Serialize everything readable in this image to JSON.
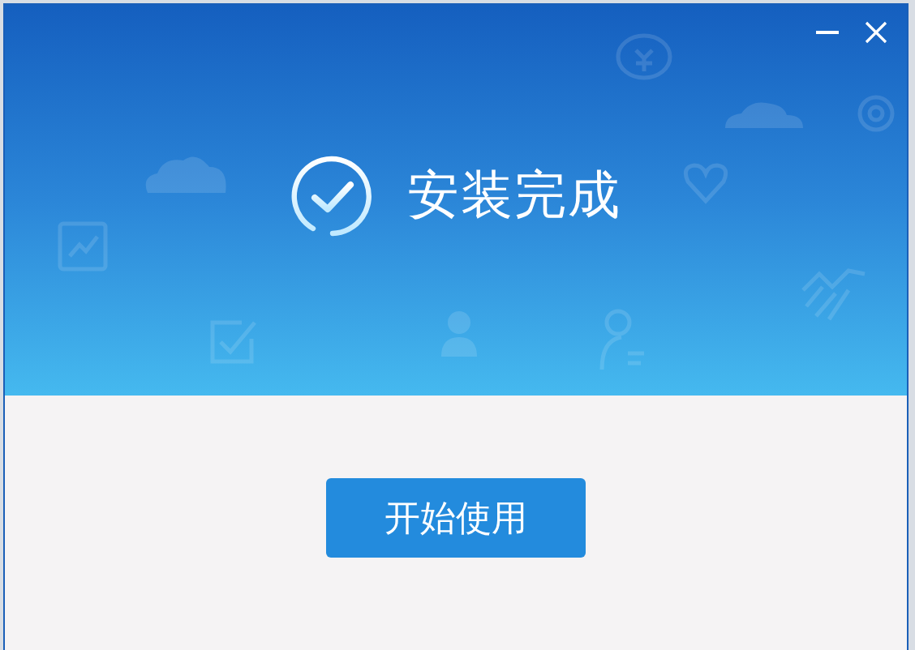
{
  "window": {
    "controls": [
      {
        "kind": "minimize"
      },
      {
        "kind": "close"
      }
    ]
  },
  "banner": {
    "status": "安装完成"
  },
  "buttons": [
    "开始使用"
  ]
}
